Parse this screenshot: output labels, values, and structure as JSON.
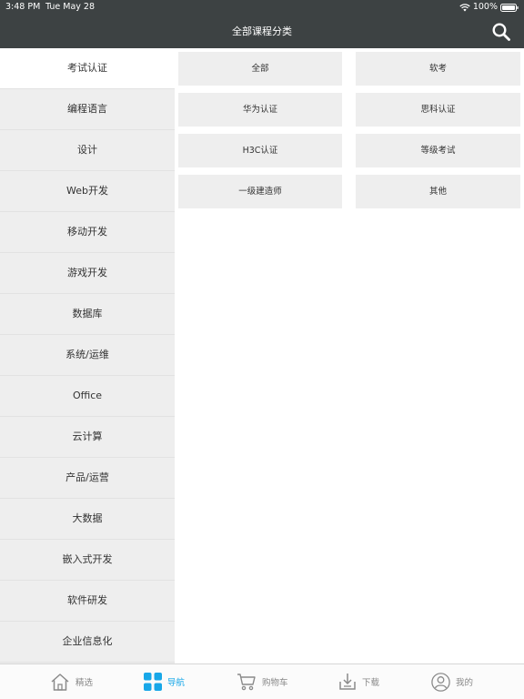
{
  "status_bar": {
    "time": "3:48 PM",
    "date": "Tue May 28",
    "battery": "100%"
  },
  "nav": {
    "title": "全部课程分类",
    "search_icon": "search-icon"
  },
  "sidebar": {
    "items": [
      {
        "label": "考试认证",
        "active": true
      },
      {
        "label": "编程语言"
      },
      {
        "label": "设计"
      },
      {
        "label": "Web开发"
      },
      {
        "label": "移动开发"
      },
      {
        "label": "游戏开发"
      },
      {
        "label": "数据库"
      },
      {
        "label": "系统/运维"
      },
      {
        "label": "Office"
      },
      {
        "label": "云计算"
      },
      {
        "label": "产品/运营"
      },
      {
        "label": "大数据"
      },
      {
        "label": "嵌入式开发"
      },
      {
        "label": "软件研发"
      },
      {
        "label": "企业信息化"
      }
    ]
  },
  "content": {
    "subcategories": [
      {
        "label": "全部"
      },
      {
        "label": "软考"
      },
      {
        "label": "华为认证"
      },
      {
        "label": "思科认证"
      },
      {
        "label": "H3C认证"
      },
      {
        "label": "等级考试"
      },
      {
        "label": "一级建造师"
      },
      {
        "label": "其他"
      }
    ]
  },
  "tab_bar": {
    "tabs": [
      {
        "label": "精选",
        "icon": "home-icon"
      },
      {
        "label": "导航",
        "icon": "grid-icon",
        "active": true
      },
      {
        "label": "购物车",
        "icon": "cart-icon"
      },
      {
        "label": "下载",
        "icon": "download-icon"
      },
      {
        "label": "我的",
        "icon": "user-icon"
      }
    ]
  },
  "colors": {
    "header_bg": "#3d4243",
    "accent": "#17a7e8",
    "sidebar_bg": "#eeeeee",
    "cell_bg": "#eeeeee"
  }
}
